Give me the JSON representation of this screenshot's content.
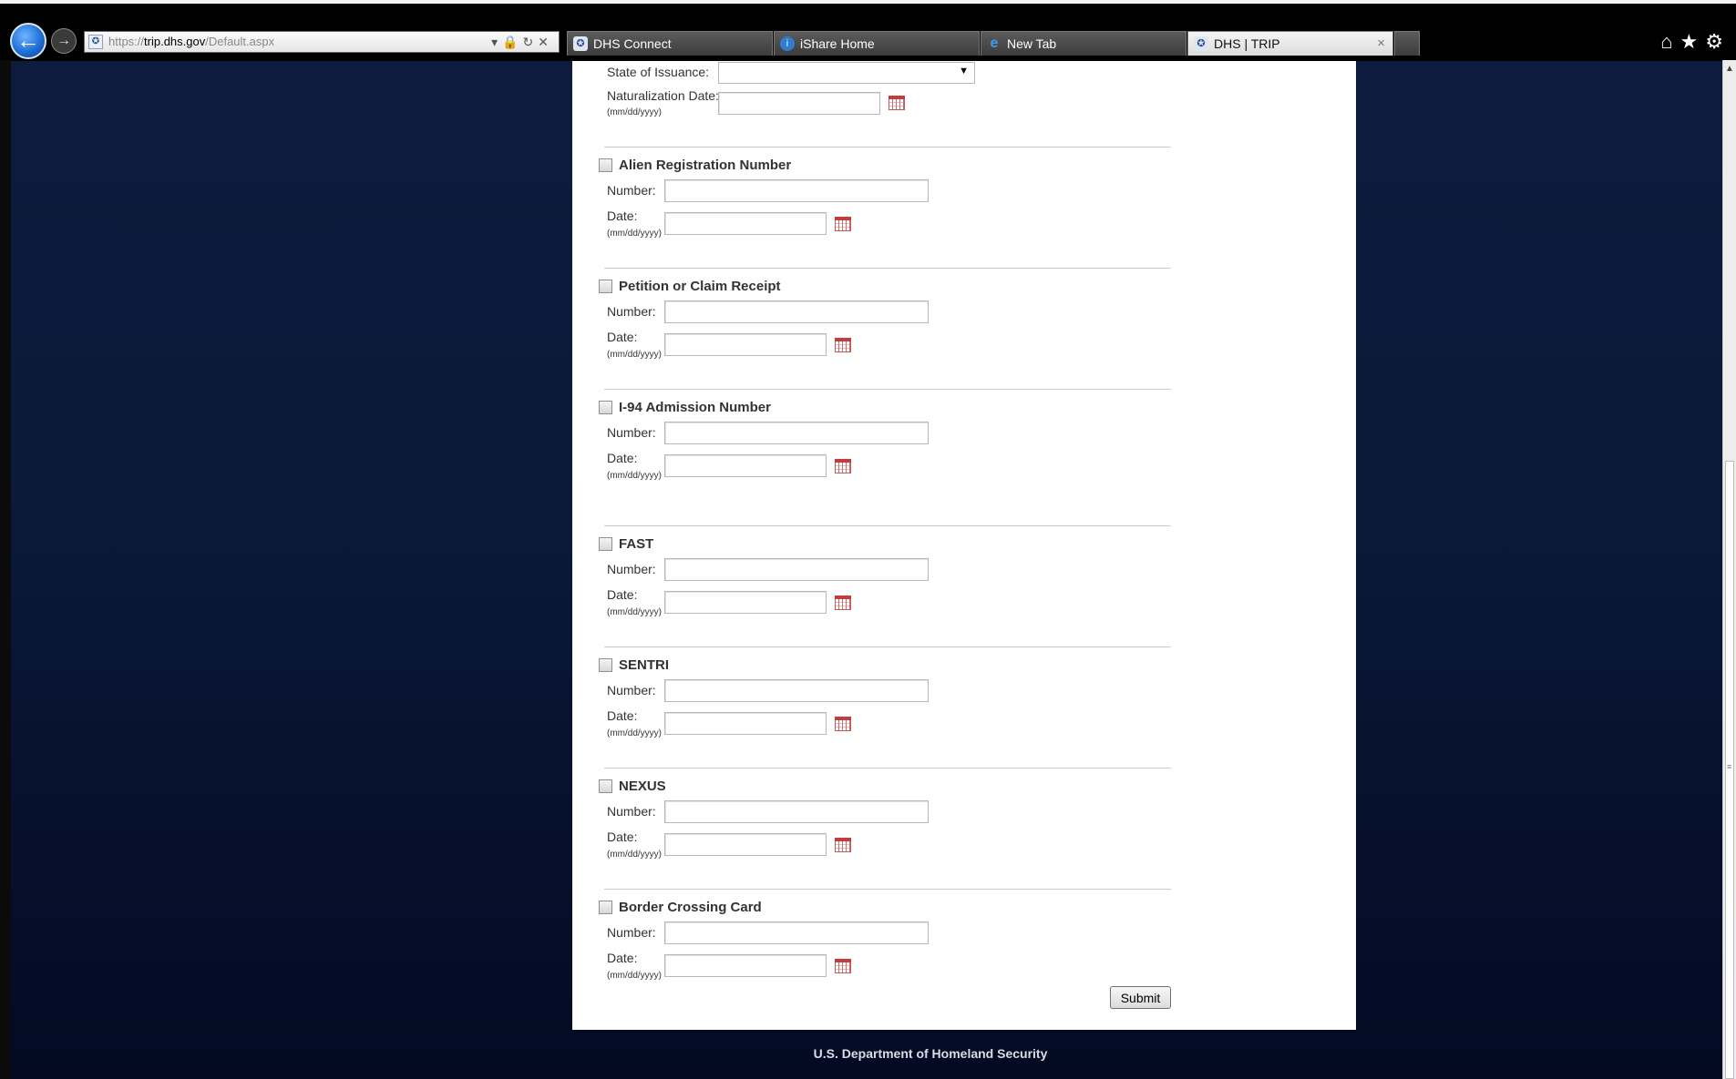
{
  "browser": {
    "url_scheme": "https://",
    "url_host": "trip.dhs.gov",
    "url_path": "/Default.aspx",
    "tabs": [
      {
        "label": "DHS Connect",
        "icon": "dhs-seal-icon",
        "active": false
      },
      {
        "label": "iShare Home",
        "icon": "info-icon",
        "active": false
      },
      {
        "label": "New Tab",
        "icon": "ie-logo-icon",
        "active": false
      },
      {
        "label": "DHS | TRIP",
        "icon": "dhs-seal-icon",
        "active": true
      }
    ],
    "close_tab_glyph": "×"
  },
  "form": {
    "state_label": "State of Issuance:",
    "nat_date_label": "Naturalization Date:",
    "date_hint": "(mm/dd/yyyy)",
    "number_label": "Number:",
    "date_label": "Date:",
    "sections": [
      {
        "title": "Alien Registration Number"
      },
      {
        "title": "Petition or Claim Receipt"
      },
      {
        "title": "I-94 Admission Number"
      },
      {
        "title": "FAST"
      },
      {
        "title": "SENTRI"
      },
      {
        "title": "NEXUS"
      },
      {
        "title": "Border Crossing Card"
      }
    ],
    "submit_label": "Submit"
  },
  "footer": {
    "text": "U.S. Department of Homeland Security"
  }
}
